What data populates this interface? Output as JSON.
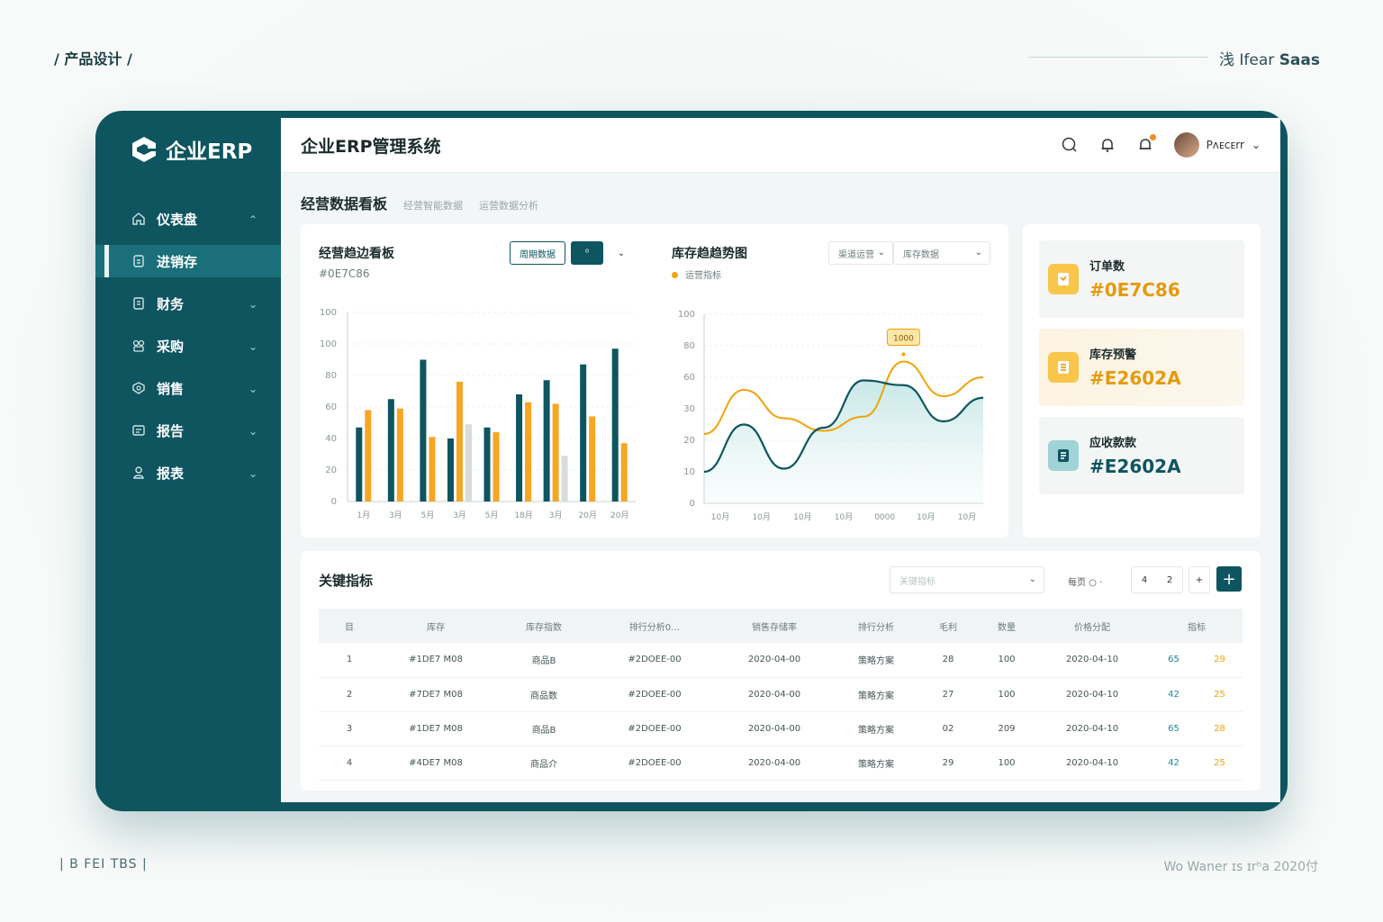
{
  "decor": {
    "top_left": "/ 产品设计 /",
    "top_right_prefix": "浅 I⁠fe⁠ar",
    "top_right_saas": "Saas",
    "bottom_left": "| B FEI TBS |",
    "bottom_right": "Wo Waner ɪs ɪrʰa 2020付"
  },
  "sidebar": {
    "brand": "企业ERP",
    "items": [
      {
        "label": "仪表盘",
        "icon": "home-icon",
        "chev": "⌃"
      },
      {
        "label": "进销存",
        "icon": "inventory-icon",
        "chev": ""
      },
      {
        "label": "财务",
        "icon": "finance-icon",
        "chev": "⌄"
      },
      {
        "label": "采购",
        "icon": "purchase-icon",
        "chev": "⌄"
      },
      {
        "label": "销售",
        "icon": "sales-icon",
        "chev": "⌄"
      },
      {
        "label": "报告",
        "icon": "report-icon",
        "chev": "⌄"
      },
      {
        "label": "报表",
        "icon": "user-icon",
        "chev": "⌄"
      }
    ]
  },
  "header": {
    "title": "企业ERP管理系统",
    "user_name": "Pᴧᴇᴄᴇrr"
  },
  "dashboard": {
    "title": "经营数据看板",
    "subtitles": [
      "经营智能数据",
      "运营数据分析"
    ]
  },
  "bar_card": {
    "title": "经营趋边看板",
    "subtitle": "#0E7C86",
    "btn_outline": "周期数据",
    "btn_solid": "⁰",
    "btn_chev": "⌄"
  },
  "line_card": {
    "title": "库存趋趋势图",
    "legend": "运营指标",
    "select1": "渠道运营",
    "select2": "库存数据",
    "tooltip": "1000"
  },
  "kpis": [
    {
      "label": "订单数",
      "value": "#0E7C86",
      "icon": "order-icon",
      "value_color": "#e59a0c"
    },
    {
      "label": "库存预警",
      "value": "#E2602A",
      "icon": "alert-icon",
      "value_color": "#e59a0c"
    },
    {
      "label": "应收款款",
      "value": "#E2602A",
      "icon": "receivable-icon",
      "value_color": "#0e5560"
    }
  ],
  "table": {
    "title": "关键指标",
    "filter_placeholder": "关键指标",
    "page_label": "每页 ○ ·",
    "page_a": "4",
    "page_b": "2",
    "plus_small": "+",
    "plus_big": "+",
    "headers": [
      "目",
      "库存",
      "库存指数",
      "排行分析0…",
      "销售存储率",
      "排行分析",
      "毛利",
      "数量",
      "价格分配",
      "指标"
    ],
    "rows": [
      [
        "1",
        "#1DE7 M08",
        "商品B",
        "#2DOEE-00",
        "2020-04-00",
        "策略方案",
        "28",
        "100",
        "2020-04-10",
        "65",
        "29"
      ],
      [
        "2",
        "#7DE7 M08",
        "商品数",
        "#2DOEE-00",
        "2020-04-00",
        "策略方案",
        "27",
        "100",
        "2020-04-10",
        "42",
        "25"
      ],
      [
        "3",
        "#1DE7 M08",
        "商品B",
        "#2DOEE-00",
        "2020-04-00",
        "策略方案",
        "02",
        "209",
        "2020-04-10",
        "65",
        "28"
      ],
      [
        "4",
        "#4DE7 M08",
        "商品介",
        "#2DOEE-00",
        "2020-04-00",
        "策略方案",
        "29",
        "100",
        "2020-04-10",
        "42",
        "25"
      ]
    ]
  },
  "chart_data": [
    {
      "type": "bar",
      "categories": [
        "1月",
        "3月",
        "5月",
        "3月",
        "5月",
        "18月",
        "3月",
        "20月",
        "20月"
      ],
      "ylim": [
        0,
        120
      ],
      "yticks": [
        "0",
        "20",
        "40",
        "60",
        "80",
        "100",
        "100"
      ],
      "series": [
        {
          "color": "#0e5560",
          "values": [
            47,
            65,
            90,
            40,
            47,
            68,
            77,
            87,
            97
          ]
        },
        {
          "color": "#f5a623",
          "values": [
            58,
            59,
            41,
            76,
            44,
            63,
            62,
            54,
            37
          ]
        },
        {
          "color": "#d8dcdc",
          "values": [
            0,
            0,
            0,
            49,
            0,
            0,
            29,
            0,
            0
          ]
        }
      ]
    },
    {
      "type": "area",
      "x_labels": [
        "10月",
        "10月",
        "10月",
        "10月",
        "0000",
        "10月",
        "10月"
      ],
      "yticks": [
        "0",
        "10",
        "20",
        "30",
        "60",
        "80",
        "100"
      ],
      "ylim": [
        0,
        120
      ],
      "series": [
        {
          "color": "#f0a30a",
          "values": [
            44,
            72,
            54,
            46,
            55,
            90,
            68,
            80
          ]
        },
        {
          "color": "#0e5560",
          "values": [
            20,
            50,
            22,
            48,
            78,
            75,
            52,
            67
          ]
        }
      ]
    }
  ]
}
